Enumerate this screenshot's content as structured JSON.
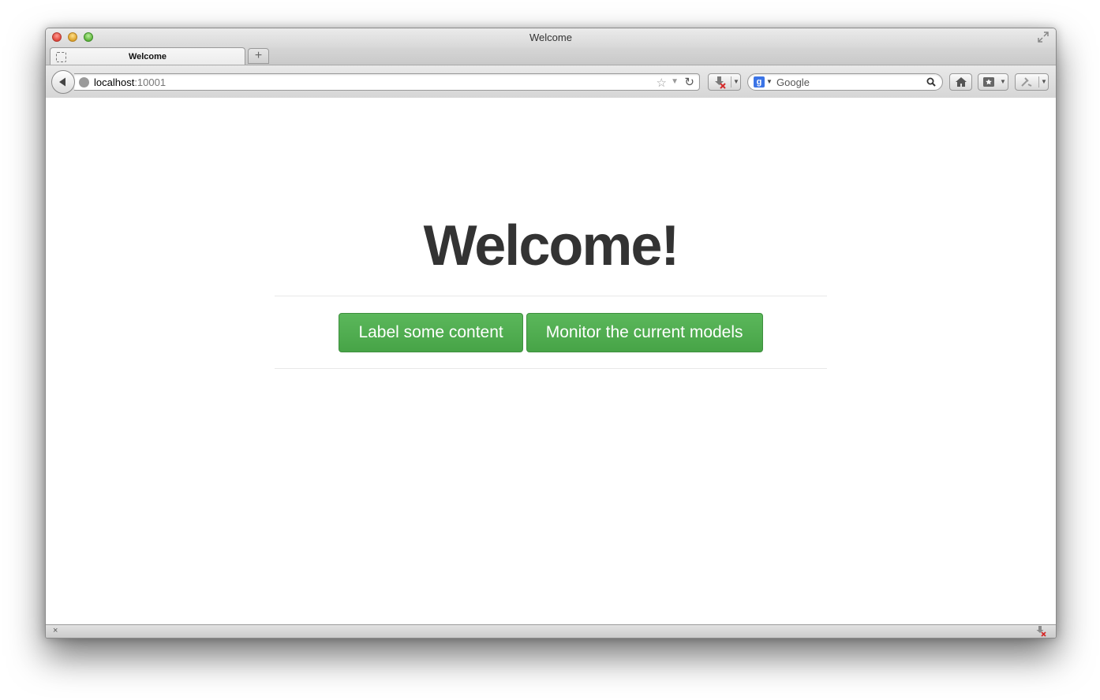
{
  "window": {
    "title": "Welcome"
  },
  "tabs": [
    {
      "label": "Welcome"
    }
  ],
  "newtab": {
    "label": "+"
  },
  "address": {
    "host": "localhost",
    "port": ":10001"
  },
  "search": {
    "placeholder": "Google"
  },
  "page": {
    "heading": "Welcome!",
    "buttons": [
      {
        "label": "Label some content"
      },
      {
        "label": "Monitor the current models"
      }
    ]
  },
  "statusbar": {
    "close_label": "×"
  },
  "icons": [
    "globe-icon",
    "star-icon",
    "reload-icon",
    "download-icon",
    "google-icon",
    "search-icon",
    "home-icon",
    "bookmarks-icon",
    "tools-icon"
  ],
  "colors": {
    "accent": "#5bb75b",
    "heading": "#333333"
  }
}
